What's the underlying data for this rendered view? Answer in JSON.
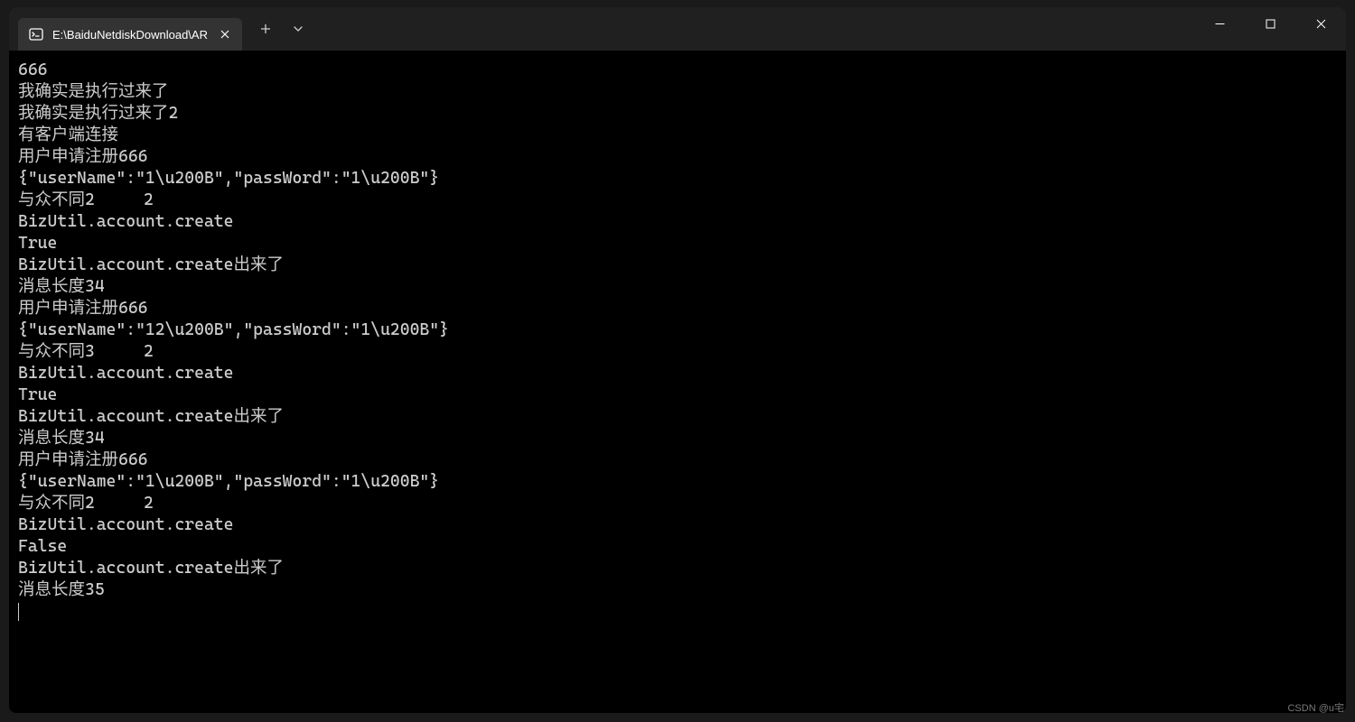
{
  "tab": {
    "title": "E:\\BaiduNetdiskDownload\\AR"
  },
  "terminal": {
    "lines": [
      "666",
      "我确实是执行过来了",
      "我确实是执行过来了2",
      "有客户端连接",
      "用户申请注册666",
      "{\"userName\":\"1\\u200B\",\"passWord\":\"1\\u200B\"}",
      "与众不同2     2",
      "BizUtil.account.create",
      "True",
      "BizUtil.account.create出来了",
      "消息长度34",
      "用户申请注册666",
      "{\"userName\":\"12\\u200B\",\"passWord\":\"1\\u200B\"}",
      "与众不同3     2",
      "BizUtil.account.create",
      "True",
      "BizUtil.account.create出来了",
      "消息长度34",
      "用户申请注册666",
      "{\"userName\":\"1\\u200B\",\"passWord\":\"1\\u200B\"}",
      "与众不同2     2",
      "BizUtil.account.create",
      "False",
      "BizUtil.account.create出来了",
      "消息长度35"
    ]
  },
  "watermark": "CSDN @u宅"
}
